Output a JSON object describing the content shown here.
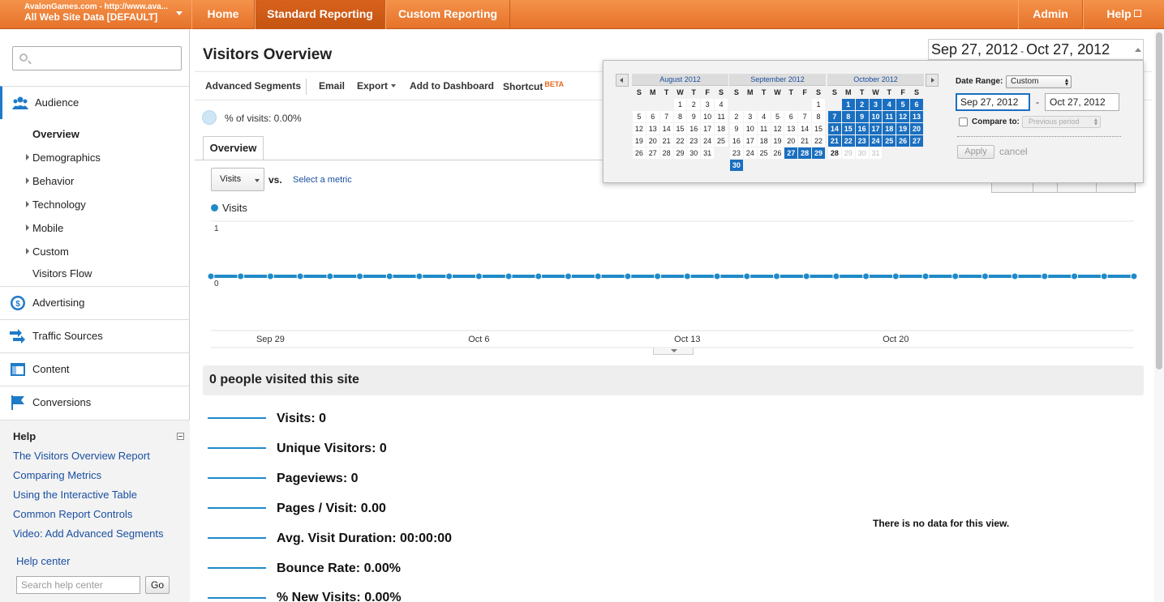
{
  "account": {
    "line1": "AvalonGames.com - http://www.ava...",
    "line2": "All Web Site Data [DEFAULT]"
  },
  "nav": {
    "tabs": [
      "Home",
      "Standard Reporting",
      "Custom Reporting"
    ],
    "active": "Standard Reporting",
    "admin": "Admin",
    "help": "Help"
  },
  "sidebar": {
    "search_placeholder": "",
    "audience": "Audience",
    "audience_items": [
      "Overview",
      "Demographics",
      "Behavior",
      "Technology",
      "Mobile",
      "Custom",
      "Visitors Flow"
    ],
    "sections": [
      "Advertising",
      "Traffic Sources",
      "Content",
      "Conversions"
    ],
    "help_title": "Help",
    "help_links": [
      "The Visitors Overview Report",
      "Comparing Metrics",
      "Using the Interactive Table",
      "Common Report Controls",
      "Video: Add Advanced Segments"
    ],
    "help_center": "Help center",
    "help_search_placeholder": "Search help center",
    "go": "Go"
  },
  "page": {
    "title": "Visitors Overview",
    "toolbar": {
      "advanced_segments": "Advanced Segments",
      "email": "Email",
      "export": "Export",
      "add_to_dashboard": "Add to Dashboard",
      "shortcut": "Shortcut",
      "beta": "BETA"
    },
    "segment_text": "% of visits: 0.00%",
    "tab": "Overview",
    "metric": "Visits",
    "vs": "vs.",
    "select_metric": "Select a metric"
  },
  "chart_data": {
    "type": "line",
    "series": [
      {
        "name": "Visits",
        "values": [
          0,
          0,
          0,
          0,
          0,
          0,
          0,
          0,
          0,
          0,
          0,
          0,
          0,
          0,
          0,
          0,
          0,
          0,
          0,
          0,
          0,
          0,
          0,
          0,
          0,
          0,
          0,
          0,
          0,
          0,
          0,
          0
        ]
      }
    ],
    "x": [
      "Sep 27",
      "Sep 28",
      "Sep 29",
      "Sep 30",
      "Oct 1",
      "Oct 2",
      "Oct 3",
      "Oct 4",
      "Oct 5",
      "Oct 6",
      "Oct 7",
      "Oct 8",
      "Oct 9",
      "Oct 10",
      "Oct 11",
      "Oct 12",
      "Oct 13",
      "Oct 14",
      "Oct 15",
      "Oct 16",
      "Oct 17",
      "Oct 18",
      "Oct 19",
      "Oct 20",
      "Oct 21",
      "Oct 22",
      "Oct 23",
      "Oct 24",
      "Oct 25",
      "Oct 26",
      "Oct 27",
      "Oct 28"
    ],
    "xticks": [
      "Sep 29",
      "Oct 6",
      "Oct 13",
      "Oct 20"
    ],
    "yticks": [
      "1",
      "0"
    ],
    "ylim": [
      0,
      1
    ],
    "color": "#1f8ac8",
    "legend": "top-left"
  },
  "summary": {
    "title": "0 people visited this site",
    "metrics": [
      "Visits: 0",
      "Unique Visitors: 0",
      "Pageviews: 0",
      "Pages / Visit: 0.00",
      "Avg. Visit Duration: 00:00:00",
      "Bounce Rate: 0.00%",
      "% New Visits: 0.00%"
    ],
    "no_data": "There is no data for this view."
  },
  "daterange": {
    "start_big": "Sep 27, 2012",
    "sep": "-",
    "end_big": "Oct 27, 2012",
    "label": "Date Range:",
    "mode": "Custom",
    "start": "Sep 27, 2012",
    "end": "Oct 27, 2012",
    "compare_label": "Compare to:",
    "compare_value": "Previous period",
    "apply": "Apply",
    "cancel": "cancel",
    "dow": [
      "S",
      "M",
      "T",
      "W",
      "T",
      "F",
      "S"
    ],
    "months": [
      {
        "name": "August 2012",
        "offset": 3,
        "days": 31,
        "sel_from": 0,
        "sel_to": 0
      },
      {
        "name": "September 2012",
        "offset": 6,
        "days": 30,
        "sel_from": 27,
        "sel_to": 30
      },
      {
        "name": "October 2012",
        "offset": 1,
        "days": 31,
        "sel_from": 1,
        "sel_to": 27,
        "today": 28
      }
    ]
  },
  "colors": {
    "brand_orange": "#e5722a",
    "accent_blue": "#1f8ac8",
    "selected_day": "#1a6fc0"
  }
}
